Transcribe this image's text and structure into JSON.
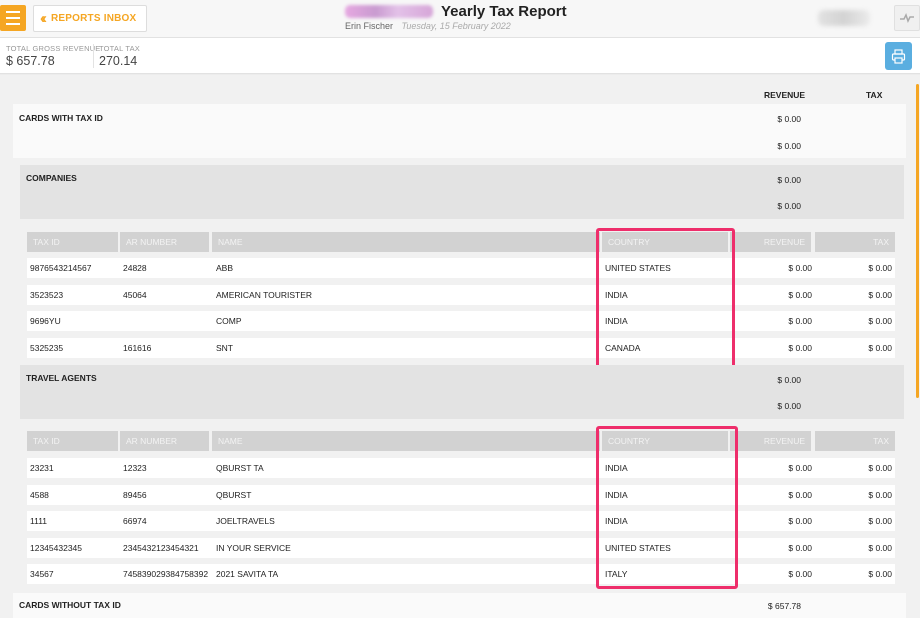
{
  "header": {
    "back_label": "REPORTS INBOX",
    "title": "Yearly Tax Report",
    "user": "Erin Fischer",
    "date": "Tuesday, 15 February 2022"
  },
  "totals": {
    "gross_label": "TOTAL GROSS REVENUE",
    "gross_value": "$ 657.78",
    "tax_label": "TOTAL TAX",
    "tax_value": "270.14"
  },
  "columns": {
    "revenue": "REVENUE",
    "tax": "TAX"
  },
  "cards_with_tax_id": {
    "title": "CARDS WITH TAX ID",
    "revenue": "$ 0.00",
    "tax": "$ 0.00"
  },
  "companies": {
    "title": "COMPANIES",
    "revenue": "$ 0.00",
    "tax": "$ 0.00",
    "headers": [
      "TAX ID",
      "AR NUMBER",
      "NAME",
      "COUNTRY",
      "REVENUE",
      "TAX"
    ],
    "rows": [
      {
        "tax_id": "9876543214567",
        "ar": "24828",
        "name": "ABB",
        "country": "UNITED STATES",
        "revenue": "$ 0.00",
        "tax": "$ 0.00"
      },
      {
        "tax_id": "3523523",
        "ar": "45064",
        "name": "AMERICAN TOURISTER",
        "country": "INDIA",
        "revenue": "$ 0.00",
        "tax": "$ 0.00"
      },
      {
        "tax_id": "9696YU",
        "ar": "",
        "name": "COMP",
        "country": "INDIA",
        "revenue": "$ 0.00",
        "tax": "$ 0.00"
      },
      {
        "tax_id": "5325235",
        "ar": "161616",
        "name": "SNT",
        "country": "CANADA",
        "revenue": "$ 0.00",
        "tax": "$ 0.00"
      }
    ]
  },
  "travel_agents": {
    "title": "TRAVEL AGENTS",
    "revenue": "$ 0.00",
    "tax": "$ 0.00",
    "headers": [
      "TAX ID",
      "AR NUMBER",
      "NAME",
      "COUNTRY",
      "REVENUE",
      "TAX"
    ],
    "rows": [
      {
        "tax_id": "23231",
        "ar": "12323",
        "name": "QBURST TA",
        "country": "INDIA",
        "revenue": "$ 0.00",
        "tax": "$ 0.00"
      },
      {
        "tax_id": "4588",
        "ar": "89456",
        "name": "QBURST",
        "country": "INDIA",
        "revenue": "$ 0.00",
        "tax": "$ 0.00"
      },
      {
        "tax_id": "1111",
        "ar": "66974",
        "name": "JOELTRAVELS",
        "country": "INDIA",
        "revenue": "$ 0.00",
        "tax": "$ 0.00"
      },
      {
        "tax_id": "12345432345",
        "ar": "2345432123454321",
        "name": "IN YOUR SERVICE",
        "country": "UNITED STATES",
        "revenue": "$ 0.00",
        "tax": "$ 0.00"
      },
      {
        "tax_id": "34567",
        "ar": "745839029384758392",
        "name": "2021 SAVITA TA",
        "country": "ITALY",
        "revenue": "$ 0.00",
        "tax": "$ 0.00"
      }
    ]
  },
  "cards_without_tax_id": {
    "title": "CARDS WITHOUT TAX ID",
    "revenue": "$ 657.78"
  },
  "colors": {
    "accent": "#f5a623",
    "print_button": "#5aaee0",
    "highlight": "#ee2e6b"
  },
  "icons": {
    "menu": "hamburger-icon",
    "back": "double-chevron-left-icon",
    "activity": "pulse-icon",
    "print": "printer-icon"
  }
}
